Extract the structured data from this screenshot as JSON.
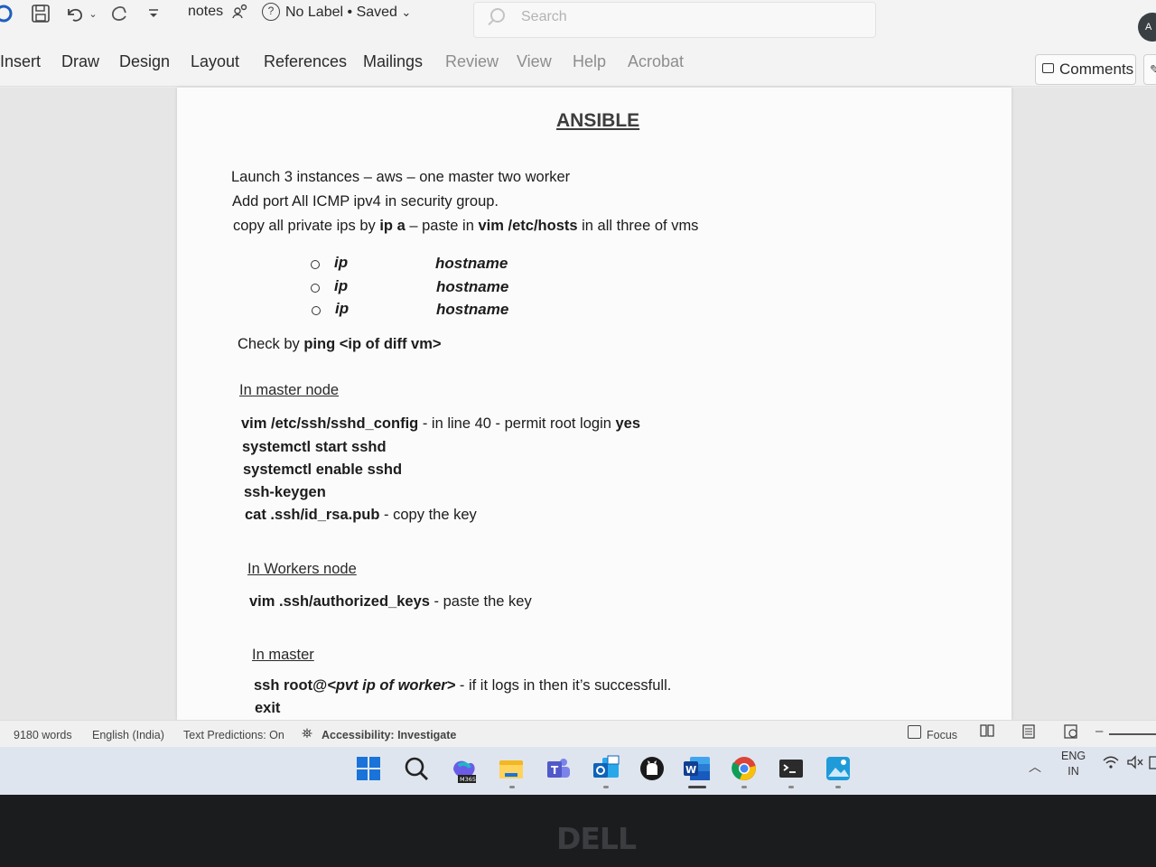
{
  "titlebar": {
    "doc_name": "notes",
    "label_status": "No Label",
    "separator": "•",
    "save_status": "Saved",
    "search_placeholder": "Search"
  },
  "ribbon": {
    "tabs": [
      "Insert",
      "Draw",
      "Design",
      "Layout",
      "References",
      "Mailings",
      "Review",
      "View",
      "Help",
      "Acrobat"
    ],
    "comments_label": "Comments"
  },
  "document": {
    "title": "ANSIBLE",
    "intro": {
      "line1": "Launch 3 instances – aws – one master two worker",
      "line2": "Add port All ICMP ipv4 in security group.",
      "line3_a": "copy all private ips by ",
      "line3_b": "ip a",
      "line3_c": " – paste in ",
      "line3_d": "vim /etc/hosts",
      "line3_e": " in all three of vms"
    },
    "hosts_list": [
      {
        "ip": "ip",
        "name": "hostname"
      },
      {
        "ip": "ip",
        "name": "hostname"
      },
      {
        "ip": "ip",
        "name": "hostname"
      }
    ],
    "check_a": "Check by ",
    "check_b": "ping <ip of diff vm>",
    "master_heading": "In master node",
    "master_cmds": {
      "c1_cmd": "vim /etc/ssh/sshd_config",
      "c1_note": "  - in line 40 - permit root login ",
      "c1_yes": "yes",
      "c2": "systemctl start sshd",
      "c3": "systemctl enable sshd",
      "c4": "ssh-keygen",
      "c5_cmd": "cat .ssh/id_rsa.pub",
      "c5_note": "  -  copy the key"
    },
    "workers_heading": "In Workers node",
    "workers_cmd": "vim .ssh/authorized_keys",
    "workers_note": "  -  paste the key",
    "master2_heading": "In master",
    "ssh_cmd_a": "ssh root@",
    "ssh_cmd_b": "<pvt ip of worker>",
    "ssh_note": "  -  if it logs in then it’s successfull.",
    "exit_cmd": "exit"
  },
  "statusbar": {
    "words": "9180 words",
    "language": "English (India)",
    "text_predictions": "Text Predictions: On",
    "accessibility": "Accessibility: Investigate",
    "focus": "Focus"
  },
  "taskbar": {
    "apps": [
      "start-icon",
      "search-icon",
      "m365-icon",
      "file-explorer-icon",
      "teams-icon",
      "outlook-icon",
      "github-icon",
      "word-icon",
      "chrome-icon",
      "terminal-icon",
      "photos-icon"
    ],
    "m365_label": "M365",
    "lang_top": "ENG",
    "lang_bottom": "IN"
  },
  "bezel": {
    "brand": "DELL"
  },
  "colors": {
    "word_blue": "#185abd",
    "page": "#fbfbfb",
    "taskbar": "#dfe5ee"
  }
}
